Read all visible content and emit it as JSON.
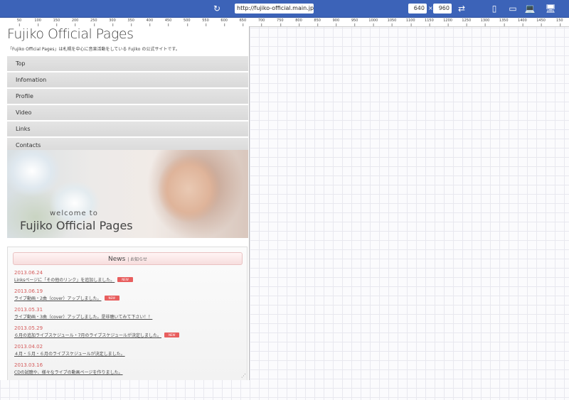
{
  "toolbar": {
    "url": "http://fujiko-official.main.jp/",
    "width": "640",
    "height": "960",
    "times": "×",
    "icons": [
      "refresh-icon",
      "rotate-icon",
      "phone-icon",
      "tablet-icon",
      "laptop-icon",
      "desktop-icon"
    ]
  },
  "ruler": [
    "50",
    "100",
    "150",
    "200",
    "250",
    "300",
    "350",
    "400",
    "450",
    "500",
    "550",
    "600",
    "650",
    "700",
    "750",
    "800",
    "850",
    "900",
    "950",
    "1000",
    "1050",
    "1100",
    "1150",
    "1200",
    "1250",
    "1300",
    "1350",
    "1400",
    "1450",
    "150"
  ],
  "site": {
    "title": "Fujiko Official Pages",
    "description": "「Fujiko Official Pages」は札幌を中心に音楽活動をしている Fujiko の公式サイトです。"
  },
  "nav": [
    "Top",
    "Infomation",
    "Profile",
    "Video",
    "Links",
    "Contacts"
  ],
  "hero": {
    "welcome": "welcome to",
    "title": "Fujiko Official Pages"
  },
  "news": {
    "title": "News",
    "subtitle": "| お知らせ",
    "badge": "NEW",
    "items": [
      {
        "date": "2013.06.24",
        "text": "Linksページに「その他のリンク」を追加しました。"
      },
      {
        "date": "2013.06.19",
        "text": "ライブ動画・2曲（cover）アップしました。"
      },
      {
        "date": "2013.05.31",
        "text": "ライブ動画・3曲（cover）アップしました。是非聴いてみて下さい！！"
      },
      {
        "date": "2013.05.29",
        "text": "６月の追加ライブスケジュール・7月のライブスケジュールが決定しました。"
      },
      {
        "date": "2013.04.02",
        "text": "４月・５月・６月のライブスケジュールが決定しました。"
      },
      {
        "date": "2013.03.16",
        "text": "CDの試聴や、様々なライブの動画ページを作りました。"
      }
    ]
  }
}
